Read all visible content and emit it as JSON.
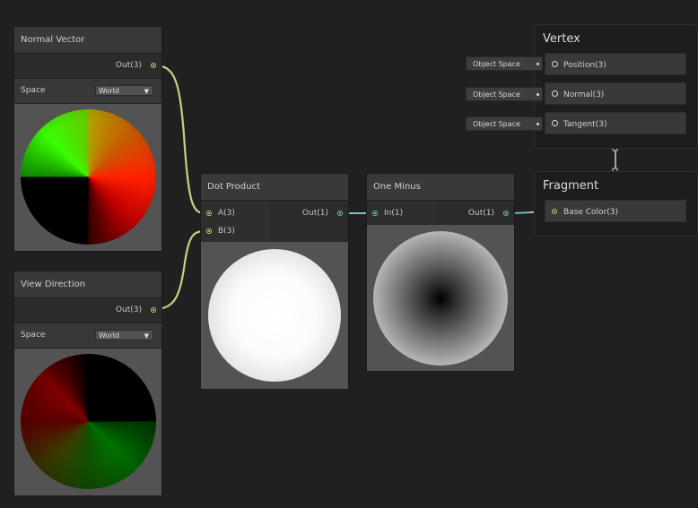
{
  "normal_vector": {
    "title": "Normal Vector",
    "output": "Out(3)",
    "space_label": "Space",
    "space_value": "World"
  },
  "view_direction": {
    "title": "View Direction",
    "output": "Out(3)",
    "space_label": "Space",
    "space_value": "World"
  },
  "dot_product": {
    "title": "Dot Product",
    "input_a": "A(3)",
    "input_b": "B(3)",
    "output": "Out(1)"
  },
  "one_minus": {
    "title": "One Minus",
    "input": "In(1)",
    "output": "Out(1)"
  },
  "vertex": {
    "title": "Vertex",
    "slots": [
      {
        "label": "Position(3)",
        "input": "Object Space"
      },
      {
        "label": "Normal(3)",
        "input": "Object Space"
      },
      {
        "label": "Tangent(3)",
        "input": "Object Space"
      }
    ]
  },
  "fragment": {
    "title": "Fragment",
    "slots": [
      {
        "label": "Base Color(3)"
      }
    ]
  },
  "colors": {
    "background": "#202020",
    "wire_vector": "#c8d085",
    "wire_float": "#6fc6c4"
  }
}
